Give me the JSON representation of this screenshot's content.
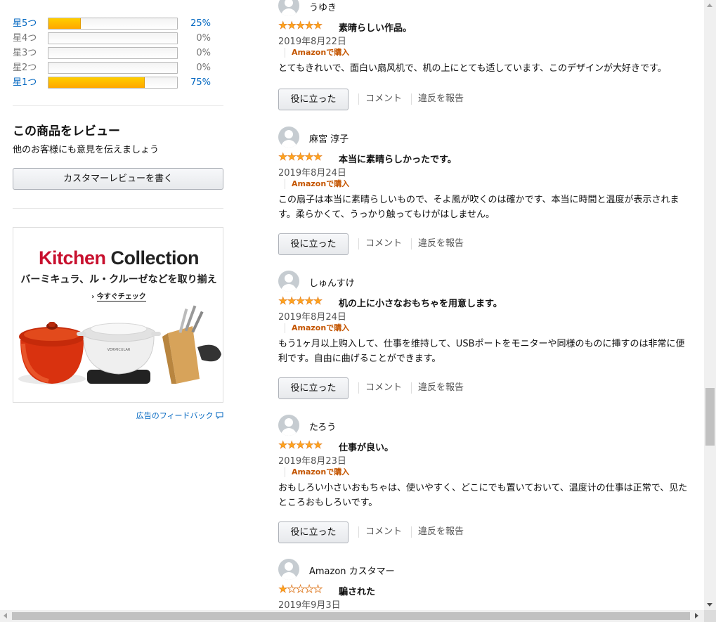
{
  "histogram": [
    {
      "label": "星5つ",
      "percent": "25%",
      "fill": 0.25,
      "active": true
    },
    {
      "label": "星4つ",
      "percent": "0%",
      "fill": 0,
      "active": false
    },
    {
      "label": "星3つ",
      "percent": "0%",
      "fill": 0,
      "active": false
    },
    {
      "label": "星2つ",
      "percent": "0%",
      "fill": 0,
      "active": false
    },
    {
      "label": "星1つ",
      "percent": "75%",
      "fill": 0.75,
      "active": true
    }
  ],
  "write_review": {
    "heading": "この商品をレビュー",
    "subtext": "他のお客様にも意見を伝えましょう",
    "button": "カスタマーレビューを書く"
  },
  "ad": {
    "title_part1": "Kitchen",
    "title_part2": "Collection",
    "subtitle": "バーミキュラ、ル・クルーゼなどを取り揃え",
    "cta": "今すぐチェック",
    "pot_brand": "VERMICULAR",
    "feedback_link": "広告のフィードバック"
  },
  "labels": {
    "verified": "Amazonで購入",
    "helpful": "役に立った",
    "comment": "コメント",
    "report": "違反を報告"
  },
  "reviews": [
    {
      "author": "うゆき",
      "rating": 5,
      "title": "素晴らしい作品。",
      "date": "2019年8月22日",
      "body": "とてもきれいで、面白い扇风机で、机の上にとても适しています、このデザインが大好きです。"
    },
    {
      "author": "麻宮 淳子",
      "rating": 5,
      "title": "本当に素晴らしかったです。",
      "date": "2019年8月24日",
      "body": "この扇子は本当に素晴らしいもので、そよ風が吹くのは確かです、本当に時間と温度が表示されます。柔らかくて、うっかり触ってもけがはしません。"
    },
    {
      "author": "しゅんすけ",
      "rating": 5,
      "title": "机の上に小さなおもちゃを用意します。",
      "date": "2019年8月24日",
      "body": "もう1ヶ月以上购入して、仕事を维持して、USBポートをモニターや同様のものに挿すのは非常に便利です。自由に曲げることができます。"
    },
    {
      "author": "たろう",
      "rating": 5,
      "title": "仕事が良い。",
      "date": "2019年8月23日",
      "body": "おもしろい小さいおもちゃは、使いやすく、どこにでも置いておいて、温度计の仕事は正常で、见たところおもしろいです。"
    },
    {
      "author": "Amazon カスタマー",
      "rating": 1,
      "title": "騙された",
      "date": "2019年9月3日",
      "body": ""
    }
  ],
  "colors": {
    "link": "#0066c0",
    "star": "#ffa41c",
    "verified": "#c45500",
    "brand_red": "#c8102e"
  }
}
